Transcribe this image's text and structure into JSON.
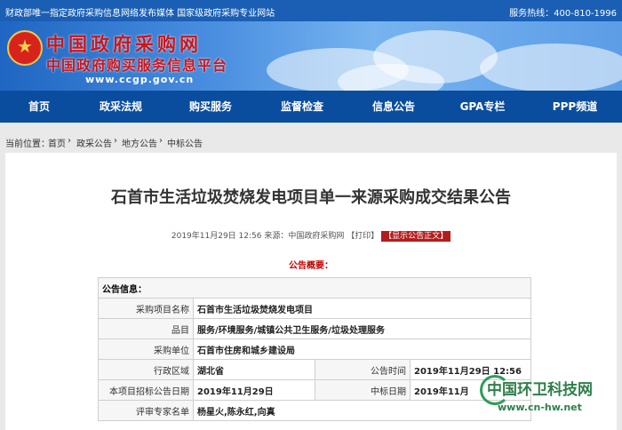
{
  "topbar": {
    "left": "财政部唯一指定政府采购信息网络发布媒体 国家级政府采购专业网站",
    "right": "服务热线：400-810-1996"
  },
  "logo": {
    "line1": "中国政府采购网",
    "line2": "中国政府购买服务信息平台",
    "url": "www.ccgp.gov.cn"
  },
  "nav": {
    "items": [
      "首页",
      "政采法规",
      "购买服务",
      "监督检查",
      "信息公告",
      "GPA专栏",
      "PPP频道"
    ]
  },
  "breadcrumb": {
    "prefix": "当前位置：",
    "items": [
      "首页",
      "政采公告",
      "地方公告",
      "中标公告"
    ]
  },
  "notice": {
    "title": "石首市生活垃圾焚烧发电项目单一来源采购成交结果公告",
    "meta": "2019年11月29日 12:56 来源：中国政府采购网 【打印】",
    "meta_tag": "【显示公告正文】",
    "summary": "公告概要：",
    "info_header": "公告信息：",
    "rows": [
      {
        "label": "采购项目名称",
        "value": "石首市生活垃圾焚烧发电项目"
      },
      {
        "label": "品目",
        "value": "服务/环境服务/城镇公共卫生服务/垃圾处理服务"
      },
      {
        "label": "采购单位",
        "value": "石首市住房和城乡建设局"
      }
    ],
    "region_label": "行政区域",
    "region_value": "湖北省",
    "pubtime_label": "公告时间",
    "pubtime_value": "2019年11月29日 12:56",
    "bid_label": "本项目招标公告日期",
    "bid_value": "2019年11月29日",
    "award_label": "中标日期",
    "award_value": "2019年11月",
    "expert_label": "评审专家名单",
    "expert_value": "杨星火,陈永红,向真"
  },
  "watermark": {
    "name": "中国环卫科技网",
    "url": "www.cn-hw.net"
  }
}
